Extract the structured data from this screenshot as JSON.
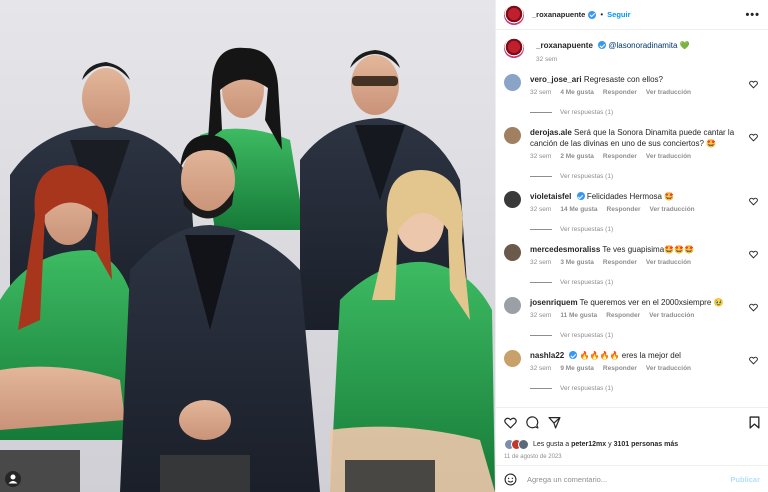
{
  "header": {
    "username": "_roxanapuente",
    "dot": "•",
    "follow_label": "Seguir",
    "more_label": "•••"
  },
  "caption": {
    "username": "_roxanapuente",
    "mention": "@lasonoradinamita",
    "emoji": "💚",
    "time": "32 sem"
  },
  "comments": [
    {
      "username": "vero_jose_ari",
      "text": "Regresaste con ellos?",
      "time": "32 sem",
      "likes": "4 Me gusta",
      "reply": "Responder",
      "translate": "Ver traducción",
      "replies": "Ver respuestas (1)",
      "avatar_color": "#8aa4c8"
    },
    {
      "username": "derojas.ale",
      "text": "Será que la Sonora Dinamita puede cantar la canción de las divinas en uno de sus conciertos? 🤩",
      "time": "32 sem",
      "likes": "2 Me gusta",
      "reply": "Responder",
      "translate": "Ver traducción",
      "replies": "Ver respuestas (1)",
      "avatar_color": "#a08060"
    },
    {
      "username": "violetaisfel",
      "text": "Felicidades Hermosa 🤩",
      "time": "32 sem",
      "likes": "14 Me gusta",
      "reply": "Responder",
      "translate": "Ver traducción",
      "replies": "Ver respuestas (1)",
      "avatar_color": "#3a3a3a",
      "verified": true
    },
    {
      "username": "mercedesmoraliss",
      "text": "Te ves guapisima🤩🤩🤩",
      "time": "32 sem",
      "likes": "3 Me gusta",
      "reply": "Responder",
      "translate": "Ver traducción",
      "replies": "Ver respuestas (1)",
      "avatar_color": "#6b5a4a"
    },
    {
      "username": "josenriquem",
      "text": "Te queremos ver en el 2000xsiempre 🥹",
      "time": "32 sem",
      "likes": "11 Me gusta",
      "reply": "Responder",
      "translate": "Ver traducción",
      "replies": "Ver respuestas (1)",
      "avatar_color": "#9aa0a6"
    },
    {
      "username": "nashla22",
      "text": "🔥🔥🔥🔥 eres la mejor del",
      "time": "32 sem",
      "likes": "9 Me gusta",
      "reply": "Responder",
      "translate": "Ver traducción",
      "replies": "Ver respuestas (1)",
      "avatar_color": "#c8a06a",
      "verified": true
    }
  ],
  "likes": {
    "prefix": "Les gusta a ",
    "user": "peter12mx",
    "middle": " y ",
    "others": "3101 personas más"
  },
  "date": "11 de agosto de 2023",
  "add_comment": {
    "placeholder": "Agrega un comentario...",
    "publish_label": "Publicar"
  },
  "colors": {
    "link": "#0095f6",
    "verified": "#3897f0",
    "muted": "#8e8e8e",
    "dress_green": "#1f9a4a"
  }
}
